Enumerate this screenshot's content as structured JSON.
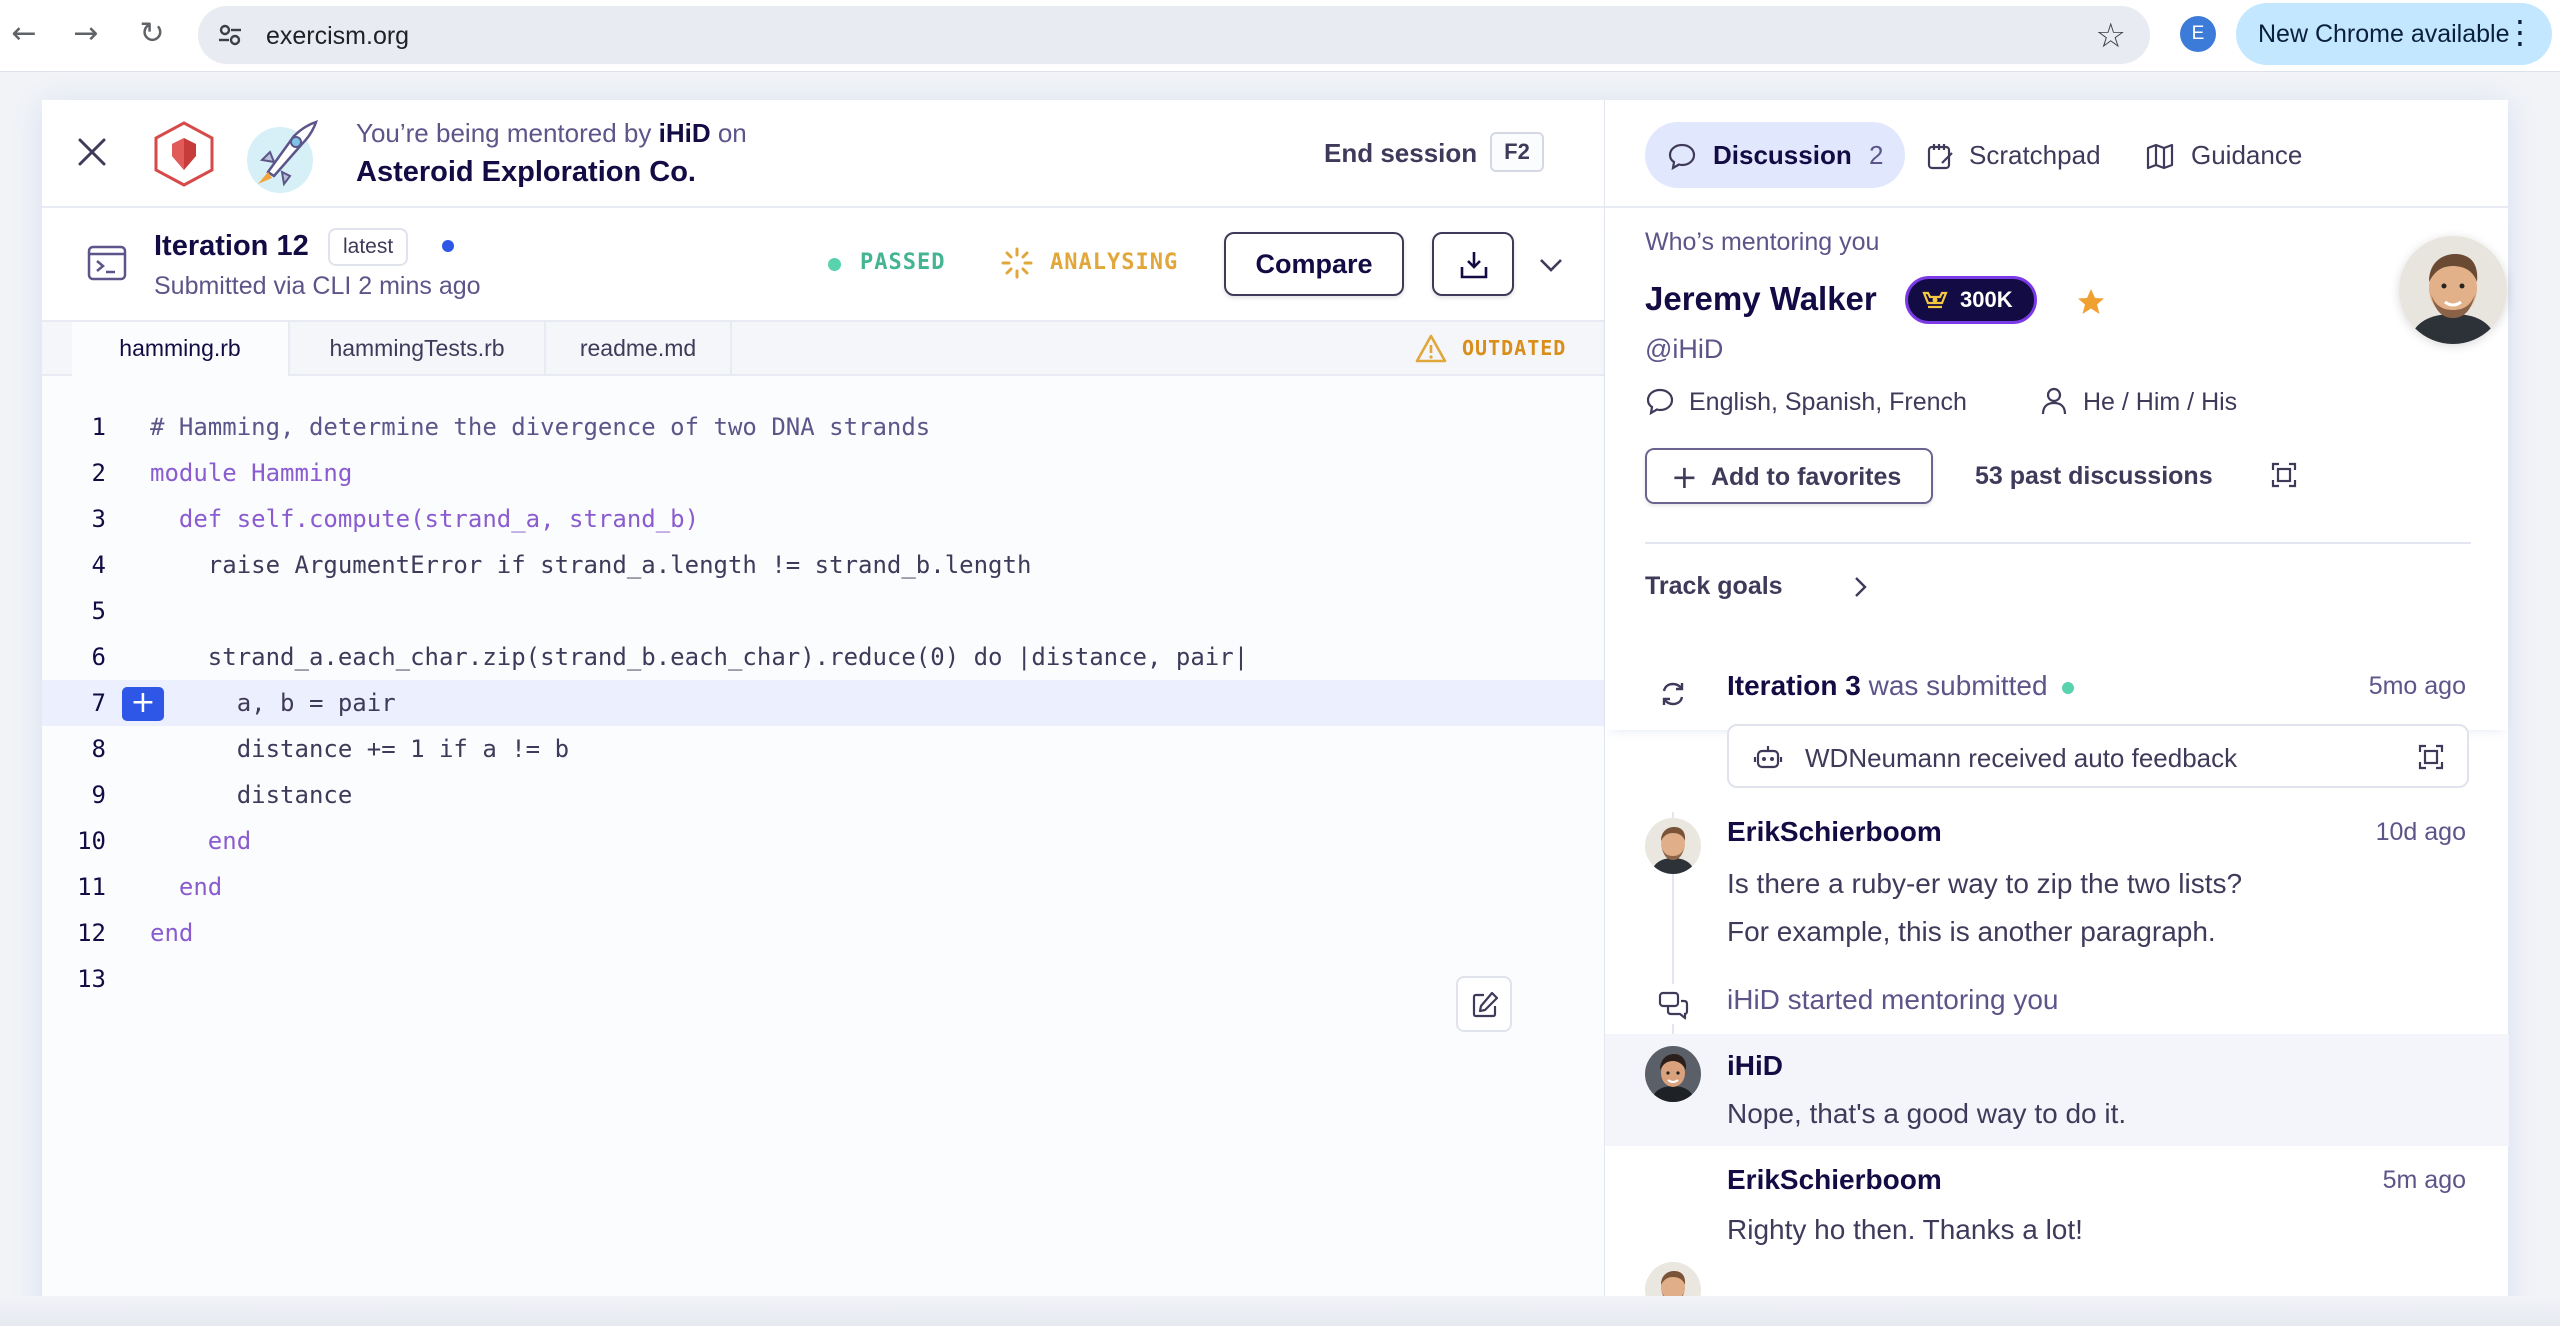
{
  "browser": {
    "url": "exercism.org",
    "profile_initial": "E",
    "update_label": "New Chrome available"
  },
  "session": {
    "mentored_prefix": "You’re being mentored by",
    "mentor_handle": "iHiD",
    "mentored_suffix": "on",
    "exercise_name": "Asteroid Exploration Co.",
    "end_session_label": "End session",
    "end_session_key": "F2"
  },
  "iteration": {
    "title": "Iteration 12",
    "tag": "latest",
    "submitted": "Submitted via CLI 2 mins ago",
    "passed_label": "PASSED",
    "analysing_label": "ANALYSING",
    "compare_label": "Compare"
  },
  "files": {
    "tabs": [
      "hamming.rb",
      "hammingTests.rb",
      "readme.md"
    ],
    "outdated_label": "OUTDATED"
  },
  "code": {
    "lines": [
      "# Hamming, determine the divergence of two DNA strands",
      "module Hamming",
      "  def self.compute(strand_a, strand_b)",
      "    raise ArgumentError if strand_a.length != strand_b.length",
      "",
      "    strand_a.each_char.zip(strand_b.each_char).reduce(0) do |distance, pair|",
      "      a, b = pair",
      "      distance += 1 if a != b",
      "      distance",
      "    end",
      "  end",
      "end",
      ""
    ],
    "highlighted_line": 7
  },
  "right_tabs": {
    "discussion": "Discussion",
    "discussion_count": "2",
    "scratchpad": "Scratchpad",
    "guidance": "Guidance"
  },
  "mentor": {
    "heading": "Who’s mentoring you",
    "name": "Jeremy Walker",
    "reputation": "300K",
    "handle": "@iHiD",
    "languages": "English, Spanish, French",
    "pronouns": "He / Him / His",
    "add_favorites": "Add to favorites",
    "past_discussions": "53 past discussions",
    "track_goals": "Track goals"
  },
  "timeline": {
    "iteration_title_bold": "Iteration 3",
    "iteration_title_rest": "was submitted",
    "iteration_time": "5mo ago",
    "auto_feedback": "WDNeumann received auto feedback",
    "post1_author": "ErikSchierboom",
    "post1_time": "10d ago",
    "post1_line1": "Is there a ruby-er way to zip the two lists?",
    "post1_line2": "For example, this is another paragraph.",
    "started": "iHiD started mentoring you",
    "post2_author": "iHiD",
    "post2_body": "Nope, that's a good way to do it.",
    "post3_author": "ErikSchierboom",
    "post3_time": "5m ago",
    "post3_body": "Righty ho then. Thanks a lot!"
  }
}
